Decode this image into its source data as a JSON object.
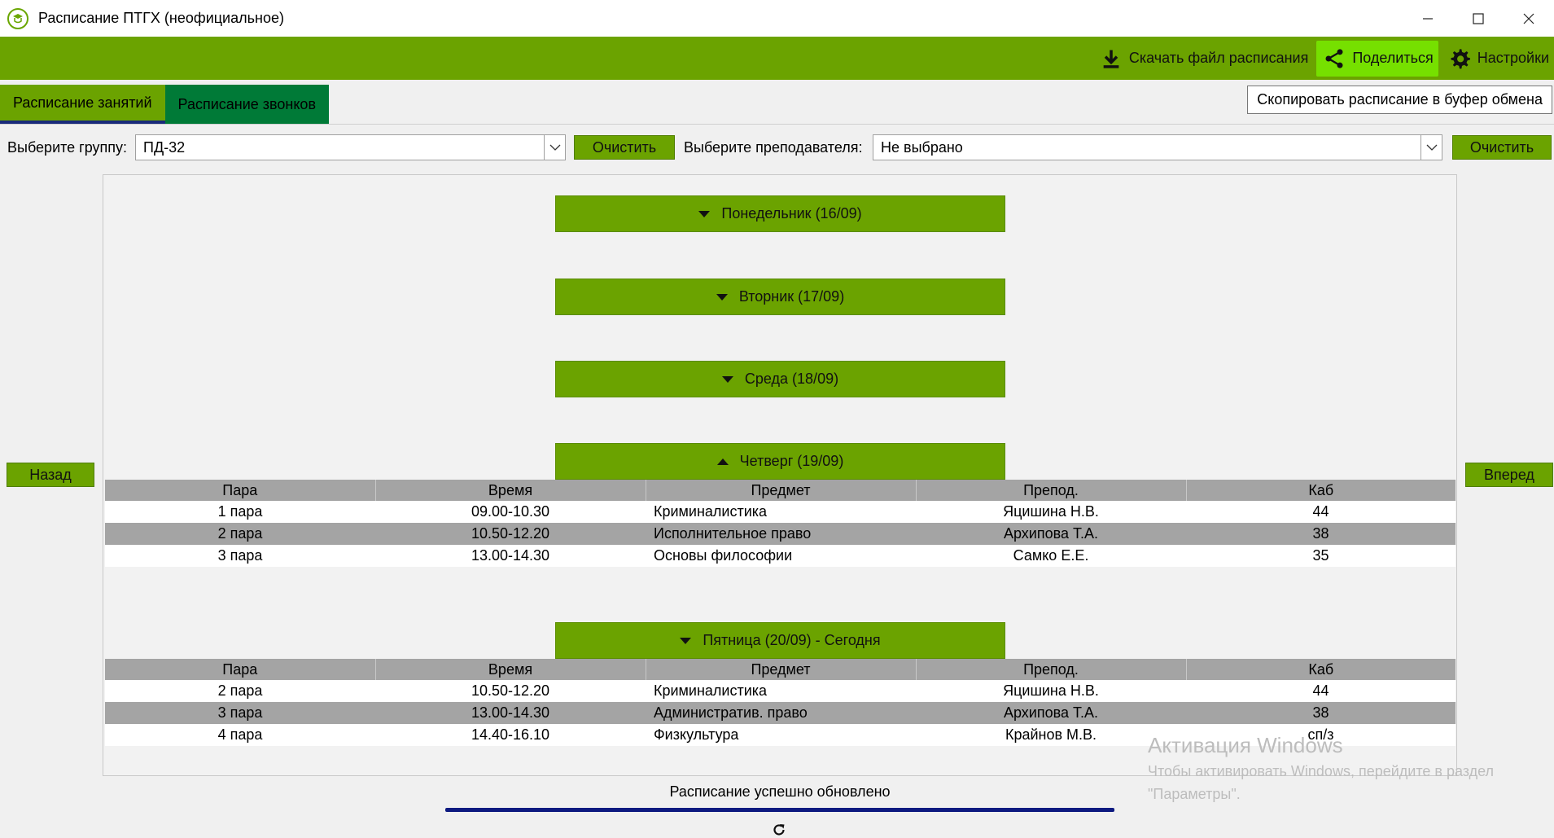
{
  "window": {
    "title": "Расписание ПТГХ (неофициальное)",
    "app_icon": "college-logo-icon",
    "controls": [
      "minimize-icon",
      "maximize-icon",
      "close-icon"
    ]
  },
  "toolbar": {
    "download_label": "Скачать файл расписания",
    "share_label": "Поделиться",
    "settings_label": "Настройки",
    "accent_color": "#6ba300",
    "highlight_color": "#76e000"
  },
  "tabs": [
    {
      "label": "Расписание занятий",
      "active": true
    },
    {
      "label": "Расписание звонков",
      "active": false
    }
  ],
  "tooltip": "Скопировать расписание в буфер обмена",
  "filters": {
    "group_label": "Выберите группу:",
    "group_value": "ПД-32",
    "clear_label": "Очистить",
    "teacher_label": "Выберите преподавателя:",
    "teacher_value": "Не выбрано"
  },
  "nav": {
    "back": "Назад",
    "forward": "Вперед"
  },
  "table_headers": [
    "Пара",
    "Время",
    "Предмет",
    "Препод.",
    "Каб"
  ],
  "days": [
    {
      "label": "Понедельник (16/09)",
      "expanded": false
    },
    {
      "label": "Вторник (17/09)",
      "expanded": false
    },
    {
      "label": "Среда (18/09)",
      "expanded": false
    },
    {
      "label": "Четверг (19/09)",
      "expanded": true,
      "rows": [
        [
          "1 пара",
          "09.00-10.30",
          "Криминалистика",
          "Яцишина Н.В.",
          "44"
        ],
        [
          "2 пара",
          "10.50-12.20",
          "Исполнительное право",
          "Архипова Т.А.",
          "38"
        ],
        [
          "3 пара",
          "13.00-14.30",
          "Основы философии",
          "Самко Е.Е.",
          "35"
        ]
      ]
    },
    {
      "label": "Пятница (20/09) - Сегодня",
      "expanded": true,
      "rows": [
        [
          "2 пара",
          "10.50-12.20",
          "Криминалистика",
          "Яцишина Н.В.",
          "44"
        ],
        [
          "3 пара",
          "13.00-14.30",
          "Административ. право",
          "Архипова Т.А.",
          "38"
        ],
        [
          "4 пара",
          "14.40-16.10",
          "Физкультура",
          "Крайнов М.В.",
          "сп/з"
        ]
      ]
    }
  ],
  "status": {
    "text": "Расписание успешно обновлено",
    "progress": 1.0
  },
  "watermark": {
    "title": "Активация Windows",
    "line1": "Чтобы активировать Windows, перейдите в раздел",
    "line2": "\"Параметры\"."
  }
}
